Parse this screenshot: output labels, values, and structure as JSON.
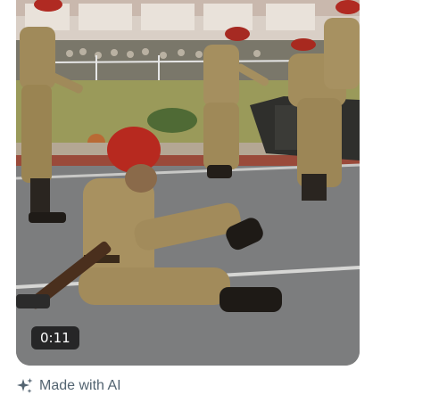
{
  "media": {
    "duration": "0:11"
  },
  "ai_label": {
    "text": "Made with AI",
    "icon": "sparkle-icon"
  },
  "colors": {
    "label_text": "#536471",
    "badge_bg": "#141414"
  }
}
